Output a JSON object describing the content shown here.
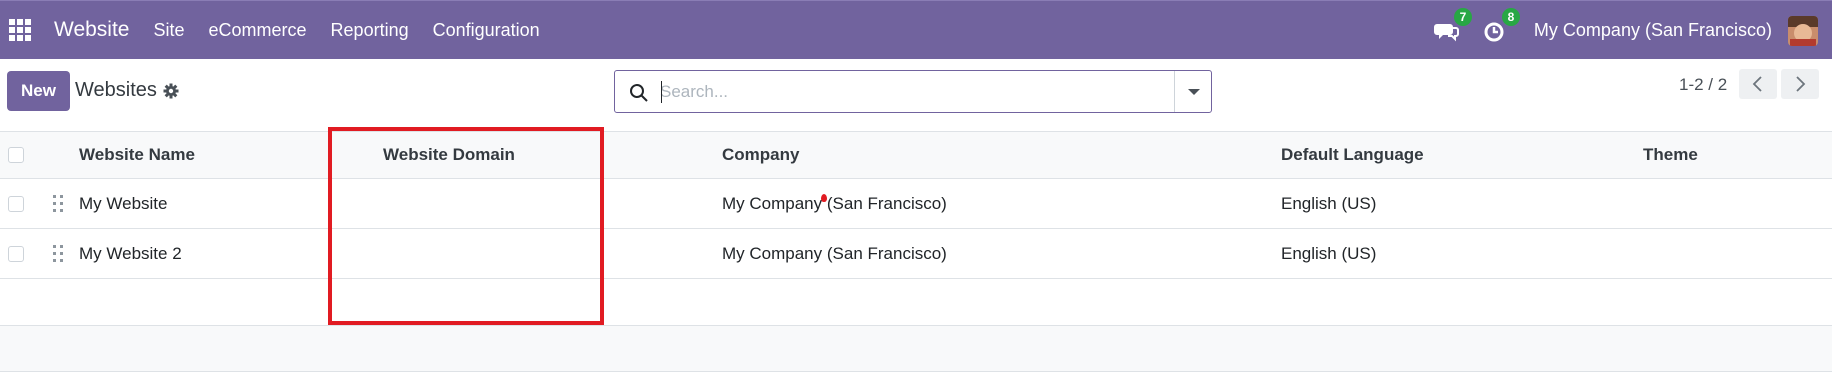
{
  "navbar": {
    "app_name": "Website",
    "menu": [
      "Site",
      "eCommerce",
      "Reporting",
      "Configuration"
    ],
    "messages_count": "7",
    "activities_count": "8",
    "company": "My Company (San Francisco)",
    "bg_color": "#71639e"
  },
  "control_panel": {
    "new_label": "New",
    "title": "Websites",
    "search_placeholder": "Search...",
    "pager_text": "1-2 / 2"
  },
  "table": {
    "columns": [
      "Website Name",
      "Website Domain",
      "Company",
      "Default Language",
      "Theme"
    ],
    "rows": [
      {
        "name": "My Website",
        "domain": "",
        "company": "My Company (San Francisco)",
        "language": "English (US)",
        "theme": ""
      },
      {
        "name": "My Website 2",
        "domain": "",
        "company": "My Company (San Francisco)",
        "language": "English (US)",
        "theme": ""
      }
    ]
  },
  "annotation": {
    "color": "#e11b22"
  }
}
